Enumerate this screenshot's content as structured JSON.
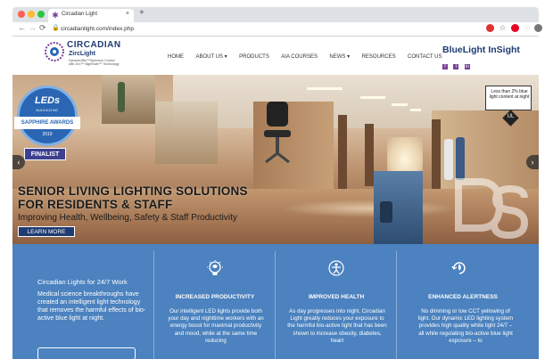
{
  "browser": {
    "tab_title": "Circadian Light",
    "tab_close": "×",
    "new_tab": "+",
    "url": "circadianlight.com/index.php",
    "back": "←",
    "forward": "→",
    "reload": "C"
  },
  "header": {
    "logo_name": "CIRCADIAN",
    "logo_sub": "ZircLight",
    "logo_tag1": "Dynamic/Bio™Spectrum Control",
    "logo_tag2": "with Zirc™ NightSafe™ Technology",
    "nav": [
      "HOME",
      "ABOUT US ▾",
      "PRODUCTS",
      "AIA COURSES",
      "NEWS ▾",
      "RESOURCES",
      "CONTACT US"
    ],
    "brand2": "BlueLight InSight",
    "social": [
      "f",
      "t",
      "in"
    ]
  },
  "hero": {
    "badge_top": "LEDs",
    "badge_mag": "MAGAZINE",
    "badge_band": "SAPPHIRE AWARDS",
    "badge_year": "2019",
    "finalist": "FINALIST",
    "callout": "Less than 2% blue light content at night",
    "callout_mark": "UL",
    "title_line1": "SENIOR LIVING LIGHTING SOLUTIONS",
    "title_line2": "FOR RESIDENTS & STAFF",
    "subtitle": "Improving Health, Wellbeing, Safety & Staff Productivity",
    "cta": "LEARN MORE",
    "arrow_left": "‹",
    "arrow_right": "›"
  },
  "features": {
    "intro_title": "Circadian Lights for 24/7 Work",
    "intro_body": "Medical science breakthroughs have created an intelligent light technology that removes the harmful effects of bio-active blue light at night.",
    "columns": [
      {
        "icon": "lightbulb-brain-icon",
        "title": "INCREASED PRODUCTIVITY",
        "body": "Our intelligent LED lights provide both your day and nighttime workers with an energy boost for maximal productivity and mood, while at the same time reducing"
      },
      {
        "icon": "health-figure-icon",
        "title": "IMPROVED HEALTH",
        "body": "As day progresses into night, Circadian Light greatly reduces your exposure to the harmful bio-active light that has been shown to increase obesity, diabetes, heart"
      },
      {
        "icon": "alert-refresh-icon",
        "title": "ENHANCED ALERTNESS",
        "body": "No dimming or low CCT yellowing of light. Our dynamic LED lighting system provides high quality white light 24/7 – all while regulating bio-active blue light exposure – to"
      }
    ]
  },
  "colors": {
    "brand_navy": "#1f3b72",
    "brand_purple": "#7b3f98",
    "feature_blue": "#4b82bf"
  }
}
